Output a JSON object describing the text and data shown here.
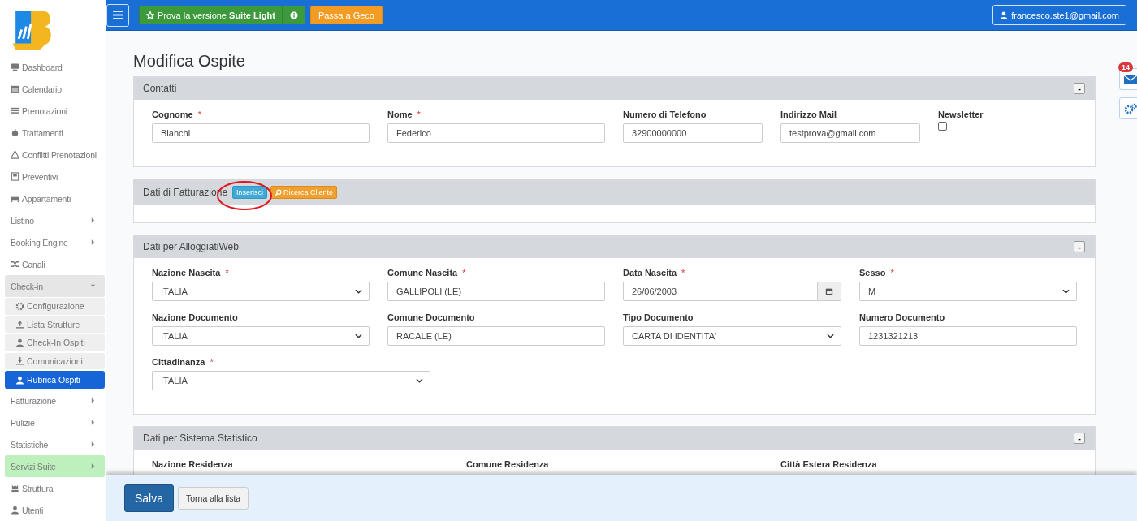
{
  "topbar": {
    "promo_button": "Prova la versione **Suite Light**",
    "geco_button": "Passa a Geco",
    "user_button": "francesco.ste1@gmail.com"
  },
  "sidebar": {
    "items": [
      {
        "label": "Dashboard",
        "kind": "link",
        "selected": false
      },
      {
        "label": "Calendario",
        "kind": "link",
        "selected": false
      },
      {
        "label": "Prenotazioni",
        "kind": "link",
        "selected": false
      },
      {
        "label": "Trattamenti",
        "kind": "link",
        "selected": false
      },
      {
        "label": "Conflitti Prenotazioni",
        "kind": "link",
        "selected": false
      },
      {
        "label": "Preventivi",
        "kind": "link",
        "selected": false
      },
      {
        "label": "Appartamenti",
        "kind": "link",
        "selected": false
      },
      {
        "label": "Listino",
        "kind": "group",
        "expanded": false,
        "highlighted": false
      },
      {
        "label": "Booking Engine",
        "kind": "group",
        "expanded": false,
        "highlighted": false
      },
      {
        "label": "Canali",
        "kind": "link",
        "selected": false
      },
      {
        "label": "Check-in",
        "kind": "group",
        "expanded": true,
        "highlighted": false,
        "children": [
          {
            "label": "Configurazione",
            "selected": false
          },
          {
            "label": "Lista Strutture",
            "selected": false
          },
          {
            "label": "Check-In Ospiti",
            "selected": false
          },
          {
            "label": "Comunicazioni",
            "selected": false
          },
          {
            "label": "Rubrica Ospiti",
            "selected": true
          }
        ]
      },
      {
        "label": "Fatturazione",
        "kind": "group",
        "expanded": false,
        "highlighted": false
      },
      {
        "label": "Pulizie",
        "kind": "group",
        "expanded": false,
        "highlighted": false
      },
      {
        "label": "Statistiche",
        "kind": "group",
        "expanded": false,
        "highlighted": false
      },
      {
        "label": "Servizi Suite",
        "kind": "group",
        "expanded": false,
        "highlighted": true
      },
      {
        "label": "Struttura",
        "kind": "link",
        "selected": false
      },
      {
        "label": "Utenti",
        "kind": "link",
        "selected": false
      }
    ]
  },
  "page_title": "Modifica Ospite",
  "panels": [
    {
      "title": "Contatti",
      "collapse_label": "-",
      "rows": [
        [
          {
            "label": "Cognome",
            "mark": "*",
            "kind": "input",
            "value": "Bianchi"
          },
          {
            "label": "Nome",
            "mark": "*",
            "kind": "input",
            "value": "Federico"
          },
          {
            "label": "Numero di Telefono",
            "kind": "input",
            "value": "32900000000"
          },
          {
            "label": "Indirizzo Mail",
            "kind": "input",
            "value": "testprova@gmail.com"
          },
          {
            "label": "Newsletter",
            "kind": "checkbox",
            "checked": false
          }
        ]
      ]
    },
    {
      "title": "Dati di Fatturazione",
      "actions": [
        {
          "label": "Inserisci",
          "kind": "info"
        },
        {
          "label": "Ricerca Cliente",
          "kind": "warning"
        }
      ],
      "annotation": {
        "kind": "ellipse"
      }
    },
    {
      "title": "Dati per AlloggiatiWeb",
      "collapse_label": "-",
      "rows": [
        [
          {
            "label": "Nazione Nascita",
            "mark": "*",
            "kind": "select",
            "value": "ITALIA"
          },
          {
            "label": "Comune Nascita",
            "mark": "*",
            "kind": "input",
            "value": "GALLIPOLI (LE)"
          },
          {
            "label": "Data Nascita",
            "mark": "*",
            "kind": "date",
            "value": "26/06/2003"
          },
          {
            "label": "Sesso",
            "mark": "*",
            "kind": "select",
            "value": "M"
          }
        ],
        [
          {
            "label": "Nazione Documento",
            "kind": "select",
            "value": "ITALIA"
          },
          {
            "label": "Comune Documento",
            "kind": "input",
            "value": "RACALE (LE)"
          },
          {
            "label": "Tipo Documento",
            "kind": "select",
            "value": "CARTA DI IDENTITA'"
          },
          {
            "label": "Numero Documento",
            "kind": "input",
            "value": "1231321213"
          }
        ],
        [
          {
            "label": "Cittadinanza",
            "mark": "*",
            "kind": "select",
            "value": "ITALIA"
          }
        ]
      ]
    },
    {
      "title": "Dati per Sistema Statistico",
      "collapse_label": "-",
      "rows": [
        [
          {
            "label": "Nazione Residenza",
            "kind": "label"
          },
          {
            "label": "Comune Residenza",
            "kind": "label"
          },
          {
            "label": "Città Estera Residenza",
            "kind": "label"
          }
        ]
      ]
    }
  ],
  "side_widgets": {
    "mail_badge": "14"
  },
  "footer": {
    "buttons": [
      {
        "label": "Salva",
        "kind": "primary"
      },
      {
        "label": "Torna alla lista",
        "kind": "default"
      }
    ]
  }
}
